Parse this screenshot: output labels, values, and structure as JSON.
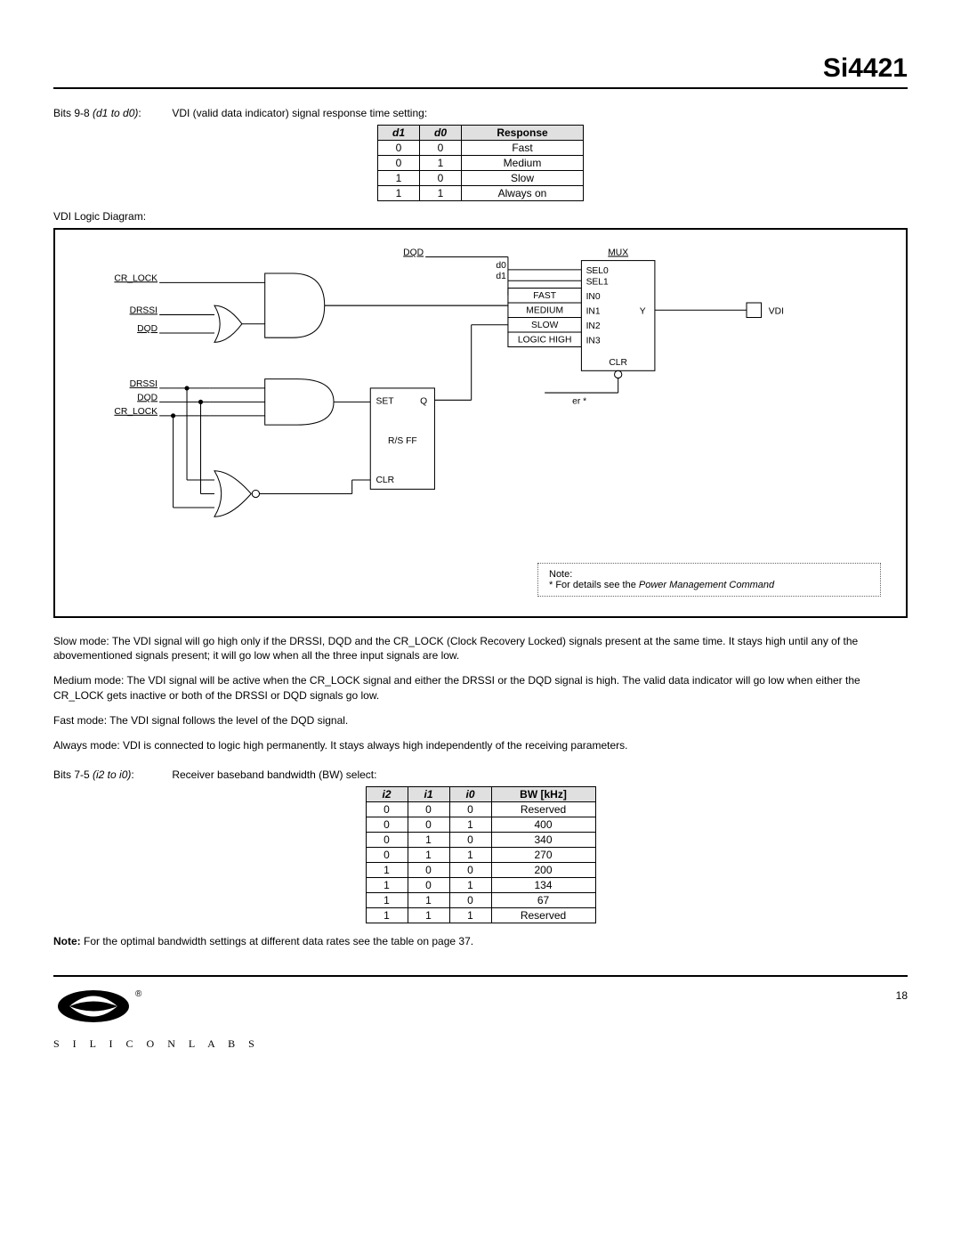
{
  "header": {
    "product": "Si4421"
  },
  "section1": {
    "bits_label_prefix": "Bits 9-8 ",
    "bits_label_ital": "(d1 to d0)",
    "bits_label_colon": ":",
    "desc": "VDI (valid data indicator) signal response time setting:"
  },
  "table1": {
    "headers": {
      "c0": "d1",
      "c1": "d0",
      "c2": "Response"
    },
    "rows": [
      {
        "c0": "0",
        "c1": "0",
        "c2": "Fast"
      },
      {
        "c0": "0",
        "c1": "1",
        "c2": "Medium"
      },
      {
        "c0": "1",
        "c1": "0",
        "c2": "Slow"
      },
      {
        "c0": "1",
        "c1": "1",
        "c2": "Always on"
      }
    ]
  },
  "diagram_label": "VDI Logic Diagram:",
  "diagram": {
    "sig_dqd_top": "DQD",
    "sig_cr_lock": "CR_LOCK",
    "sig_drssi": "DRSSI",
    "sig_dqd": "DQD",
    "sig_drssi2": "DRSSI",
    "sig_dqd2": "DQD",
    "sig_cr_lock2": "CR_LOCK",
    "mux_title": "MUX",
    "mux_d0": "d0",
    "mux_d1": "d1",
    "mux_fast": "FAST",
    "mux_medium": "MEDIUM",
    "mux_slow": "SLOW",
    "mux_logic_high": "LOGIC HIGH",
    "mux_sel0": "SEL0",
    "mux_sel1": "SEL1",
    "mux_in0": "IN0",
    "mux_in1": "IN1",
    "mux_in2": "IN2",
    "mux_in3": "IN3",
    "mux_y": "Y",
    "mux_clr": "CLR",
    "vdi": "VDI",
    "ff_set": "SET",
    "ff_q": "Q",
    "ff_name": "R/S FF",
    "ff_clr": "CLR",
    "er": "er *",
    "note_line1": "Note:",
    "note_line2_a": "* For details see the ",
    "note_line2_b": "Power Management Command"
  },
  "modes": {
    "slow": "Slow mode: The VDI signal will go high only if the DRSSI, DQD and the CR_LOCK (Clock Recovery Locked) signals present at the same time. It stays high until any of the abovementioned signals present; it will go low when all the three input signals are low.",
    "medium": "Medium mode: The VDI signal will be active when the CR_LOCK signal and either the DRSSI or the DQD signal is high. The valid data indicator will go low when either the CR_LOCK gets inactive or both of the DRSSI or DQD signals go low.",
    "fast": "Fast mode: The VDI signal follows the level of the DQD signal.",
    "always": "Always mode: VDI is connected to logic high permanently. It stays always high independently of the receiving parameters."
  },
  "section2": {
    "bits_label_prefix": "Bits 7-5 ",
    "bits_label_ital": "(i2 to i0)",
    "bits_label_colon": ":",
    "desc": "Receiver baseband bandwidth (BW) select:"
  },
  "table2": {
    "headers": {
      "c0": "i2",
      "c1": "i1",
      "c2": "i0",
      "c3": "BW [kHz]"
    },
    "rows": [
      {
        "c0": "0",
        "c1": "0",
        "c2": "0",
        "c3": "Reserved"
      },
      {
        "c0": "0",
        "c1": "0",
        "c2": "1",
        "c3": "400"
      },
      {
        "c0": "0",
        "c1": "1",
        "c2": "0",
        "c3": "340"
      },
      {
        "c0": "0",
        "c1": "1",
        "c2": "1",
        "c3": "270"
      },
      {
        "c0": "1",
        "c1": "0",
        "c2": "0",
        "c3": "200"
      },
      {
        "c0": "1",
        "c1": "0",
        "c2": "1",
        "c3": "134"
      },
      {
        "c0": "1",
        "c1": "1",
        "c2": "0",
        "c3": "67"
      },
      {
        "c0": "1",
        "c1": "1",
        "c2": "1",
        "c3": "Reserved"
      }
    ]
  },
  "bottom_note_bold": "Note:",
  "bottom_note": "  For the optimal bandwidth settings at different data rates see the table on page 37.",
  "footer": {
    "page": "18",
    "logo_text": "S I L I C O N   L A B S"
  }
}
